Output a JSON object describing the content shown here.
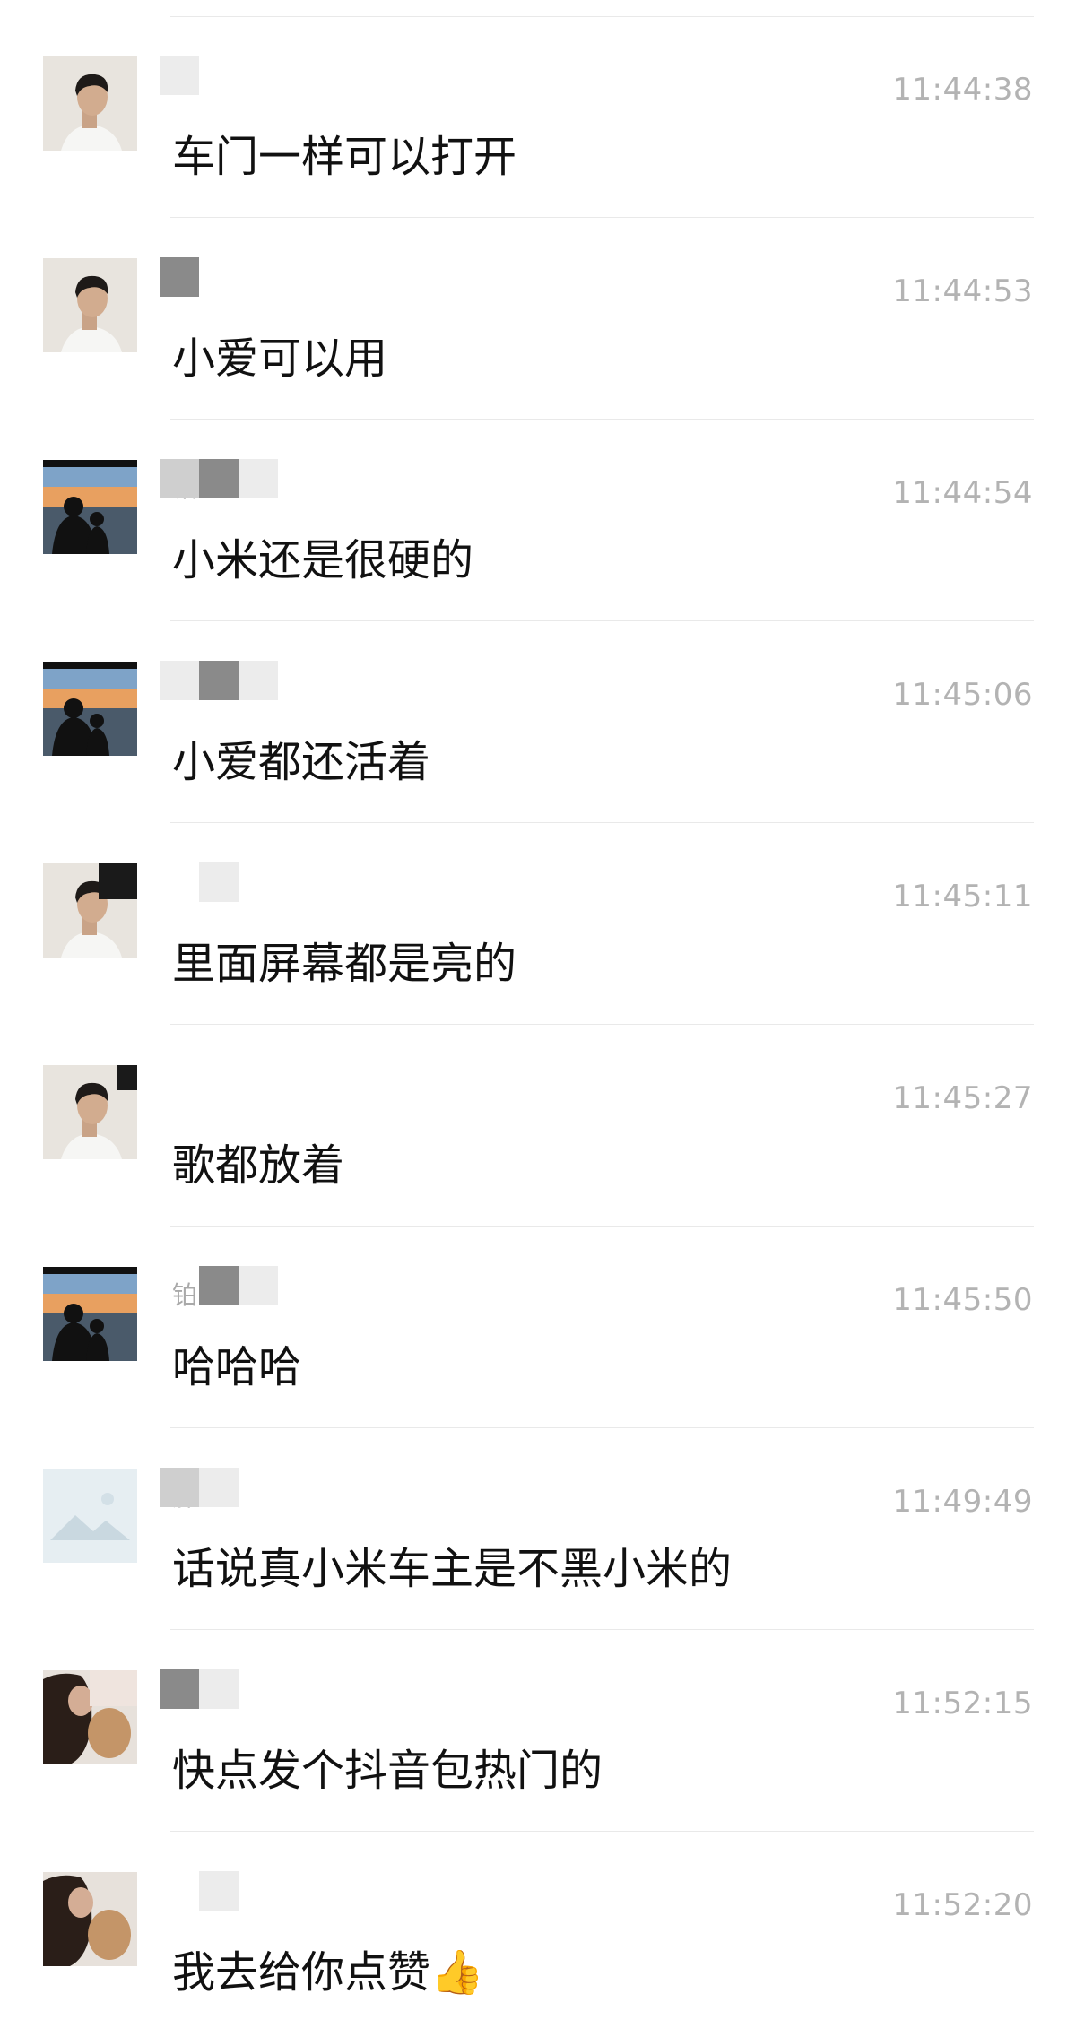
{
  "messages": [
    {
      "sender": "",
      "time": "11:44:38",
      "text": "车门一样可以打开",
      "avatar": "man-avatar"
    },
    {
      "sender": "",
      "time": "11:44:53",
      "text": "小爱可以用",
      "avatar": "man-avatar"
    },
    {
      "sender": "铂",
      "time": "11:44:54",
      "text": "小米还是很硬的",
      "avatar": "sunset-avatar"
    },
    {
      "sender": "",
      "time": "11:45:06",
      "text": "小爱都还活着",
      "avatar": "sunset-avatar"
    },
    {
      "sender": "",
      "time": "11:45:11",
      "text": "里面屏幕都是亮的",
      "avatar": "man-avatar"
    },
    {
      "sender": "",
      "time": "11:45:27",
      "text": "歌都放着",
      "avatar": "man-avatar"
    },
    {
      "sender": "铂",
      "time": "11:45:50",
      "text": "哈哈哈",
      "avatar": "sunset-avatar"
    },
    {
      "sender": "胖",
      "time": "11:49:49",
      "text": "话说真小米车主是不黑小米的",
      "avatar": "placeholder-avatar"
    },
    {
      "sender": "",
      "time": "11:52:15",
      "text": "快点发个抖音包热门的",
      "avatar": "girl-dog-avatar"
    },
    {
      "sender": "",
      "time": "11:52:20",
      "text": "我去给你点赞👍",
      "avatar": "girl-dog-avatar"
    }
  ],
  "colors": {
    "background": "#ffffff",
    "divider": "#e9e9e9",
    "timestamp": "#b3b3b3",
    "message_text": "#111111"
  }
}
